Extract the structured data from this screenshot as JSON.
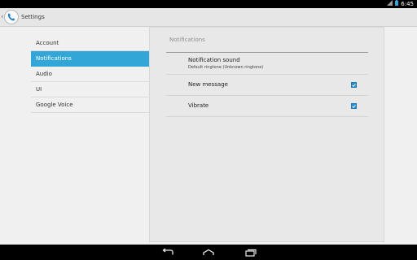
{
  "status_bar": {
    "icons": [
      "signal-icon",
      "battery-icon"
    ],
    "time": "6:45"
  },
  "action_bar": {
    "title": "Settings",
    "app_icon": "phone-icon"
  },
  "sidebar": {
    "items": [
      {
        "label": "Account",
        "selected": false
      },
      {
        "label": "Notifications",
        "selected": true
      },
      {
        "label": "Audio",
        "selected": false
      },
      {
        "label": "UI",
        "selected": false
      },
      {
        "label": "Google Voice",
        "selected": false
      }
    ]
  },
  "panel": {
    "section_header": "Notifications",
    "prefs": [
      {
        "title": "Notification sound",
        "summary": "Default ringtone (Unknown ringtone)"
      },
      {
        "title": "New message",
        "checked": true
      },
      {
        "title": "Vibrate",
        "checked": true
      }
    ]
  },
  "nav_bar": {
    "buttons": [
      "back-icon",
      "home-icon",
      "recent-apps-icon"
    ]
  },
  "colors": {
    "accent": "#33a6d8",
    "checkbox": "#2a8fcf",
    "status_bar": "#000000",
    "background": "#f0f0f0"
  }
}
